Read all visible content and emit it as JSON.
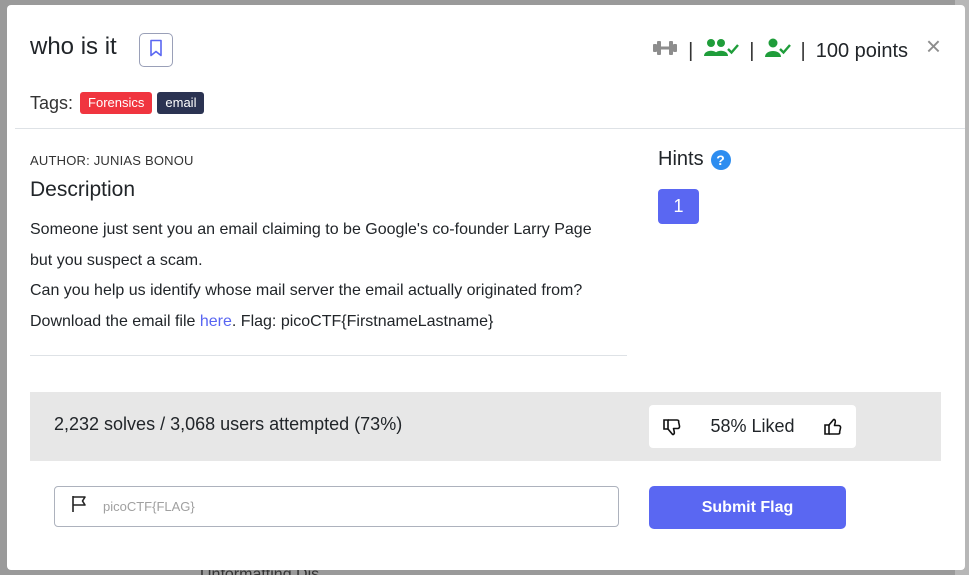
{
  "backdrop": {
    "text": "Unformatting Dis"
  },
  "modal": {
    "title": "who is it",
    "tags_label": "Tags:",
    "tags": [
      {
        "label": "Forensics",
        "color": "#f0353f"
      },
      {
        "label": "email",
        "color": "#2b3352"
      }
    ],
    "meta": {
      "separator": "|",
      "points": "100 points",
      "icons": [
        "dumbbell-icon",
        "users-check-icon",
        "user-check-icon"
      ]
    },
    "close": "×"
  },
  "description": {
    "author": "AUTHOR: JUNIAS BONOU",
    "heading": "Description",
    "line1": "Someone just sent you an email claiming to be Google's co-founder Larry Page",
    "line2": "but you suspect a scam.",
    "line3": "Can you help us identify whose mail server the email actually originated from?",
    "line4_prefix": "Download the email file ",
    "line4_link": "here",
    "line4_suffix": ". Flag: picoCTF{FirstnameLastname}"
  },
  "hints": {
    "heading": "Hints",
    "help_symbol": "?",
    "buttons": [
      "1"
    ]
  },
  "stats": {
    "solves": "2,232 solves / 3,068 users attempted (73%)",
    "liked": "58% Liked"
  },
  "flag_form": {
    "placeholder": "picoCTF{FLAG}",
    "value": "",
    "submit_label": "Submit Flag"
  },
  "colors": {
    "accent": "#5a67f2",
    "success": "#1f9d3a",
    "muted_icon": "#8d8d8d"
  }
}
